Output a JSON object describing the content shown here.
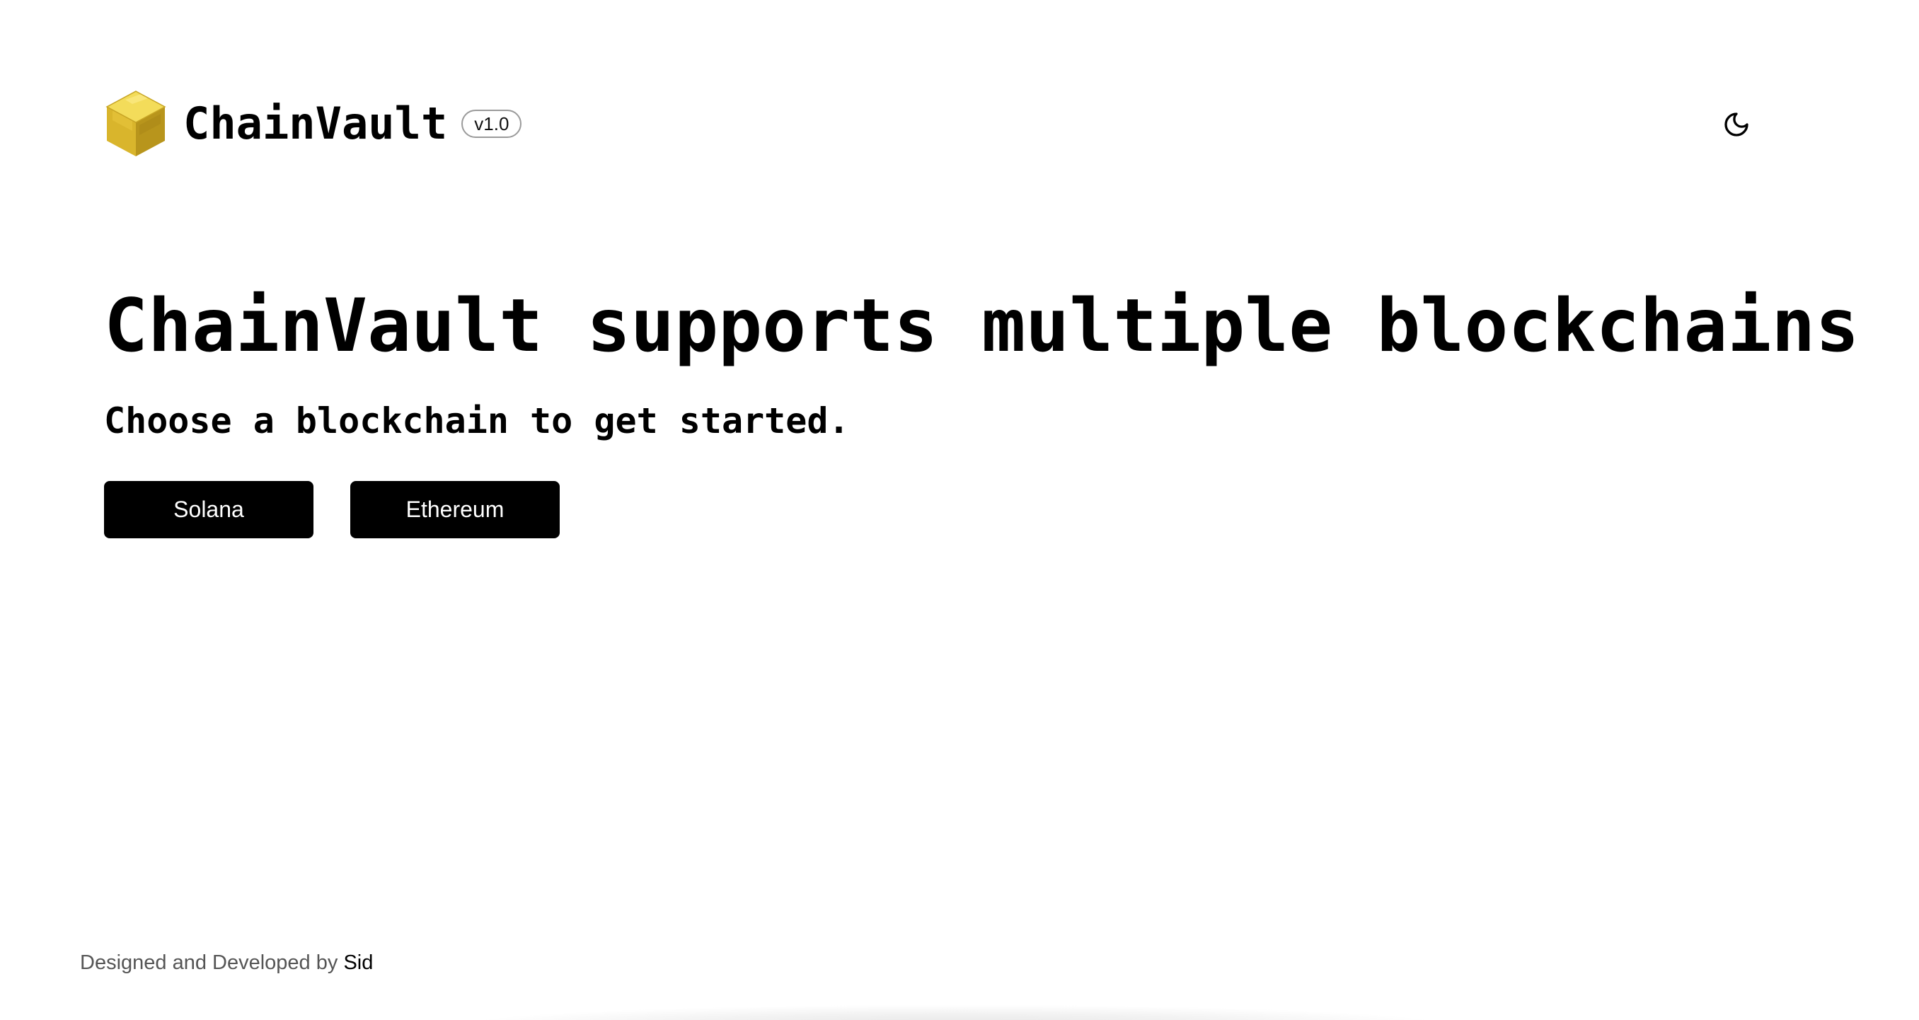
{
  "header": {
    "brand_name": "ChainVault",
    "version": "v1.0",
    "logo_icon": "gold-cube-icon",
    "theme_toggle_icon": "moon-icon"
  },
  "hero": {
    "title": "ChainVault supports multiple blockchains",
    "subtitle": "Choose a blockchain to get started."
  },
  "chains": [
    {
      "label": "Solana"
    },
    {
      "label": "Ethereum"
    }
  ],
  "footer": {
    "prefix": "Designed and Developed by",
    "author": "Sid"
  },
  "colors": {
    "background": "#ffffff",
    "text": "#000000",
    "button_bg": "#000000",
    "button_text": "#ffffff",
    "logo_gold": "#e6c63a",
    "footer_text": "#555555"
  }
}
